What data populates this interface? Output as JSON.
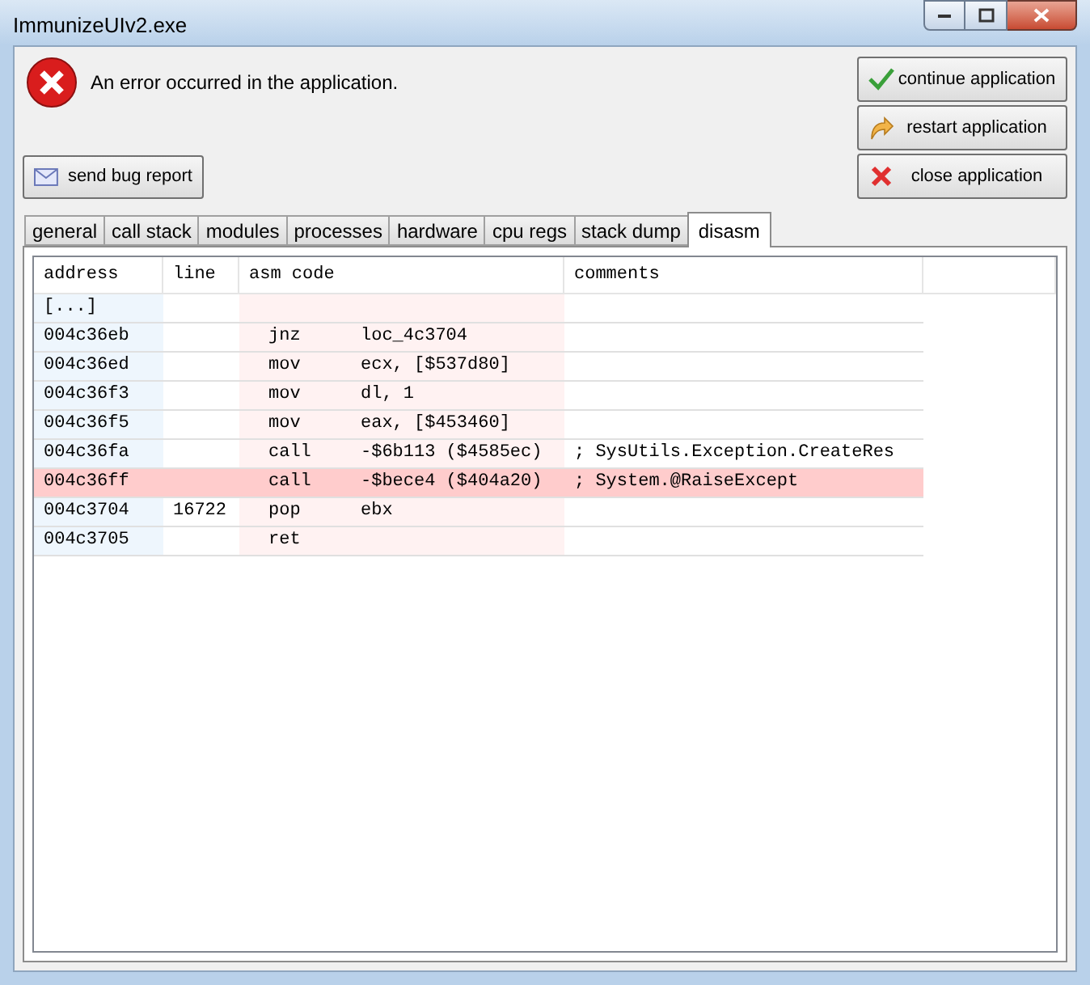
{
  "window": {
    "title": "ImmunizeUIv2.exe"
  },
  "message": "An error occurred in the application.",
  "actions": [
    {
      "kind": "continue",
      "label": "continue application"
    },
    {
      "kind": "restart",
      "label": "restart application"
    },
    {
      "kind": "close",
      "label": "close application"
    }
  ],
  "send_button": "send bug report",
  "tabs": [
    {
      "label": "general",
      "selected": false
    },
    {
      "label": "call stack",
      "selected": false
    },
    {
      "label": "modules",
      "selected": false
    },
    {
      "label": "processes",
      "selected": false
    },
    {
      "label": "hardware",
      "selected": false
    },
    {
      "label": "cpu regs",
      "selected": false
    },
    {
      "label": "stack dump",
      "selected": false
    },
    {
      "label": "disasm",
      "selected": true
    }
  ],
  "table": {
    "columns": [
      "address",
      "line",
      "asm code",
      "comments"
    ],
    "rows": [
      {
        "address": "[...]",
        "line": "",
        "op": "",
        "args": "",
        "comment": "",
        "selected": false
      },
      {
        "address": "004c36eb",
        "line": "",
        "op": "jnz",
        "args": "loc_4c3704",
        "comment": "",
        "selected": false
      },
      {
        "address": "004c36ed",
        "line": "",
        "op": "mov",
        "args": "ecx, [$537d80]",
        "comment": "",
        "selected": false
      },
      {
        "address": "004c36f3",
        "line": "",
        "op": "mov",
        "args": "dl, 1",
        "comment": "",
        "selected": false
      },
      {
        "address": "004c36f5",
        "line": "",
        "op": "mov",
        "args": "eax, [$453460]",
        "comment": "",
        "selected": false
      },
      {
        "address": "004c36fa",
        "line": "",
        "op": "call",
        "args": "-$6b113 ($4585ec)",
        "comment": "; SysUtils.Exception.CreateRes",
        "selected": false
      },
      {
        "address": "004c36ff",
        "line": "",
        "op": "call",
        "args": "-$bece4 ($404a20)",
        "comment": "; System.@RaiseExcept",
        "selected": true
      },
      {
        "address": "004c3704",
        "line": "16722",
        "op": "pop",
        "args": "ebx",
        "comment": "",
        "selected": false
      },
      {
        "address": "004c3705",
        "line": "",
        "op": "ret",
        "args": "",
        "comment": "",
        "selected": false
      }
    ]
  }
}
